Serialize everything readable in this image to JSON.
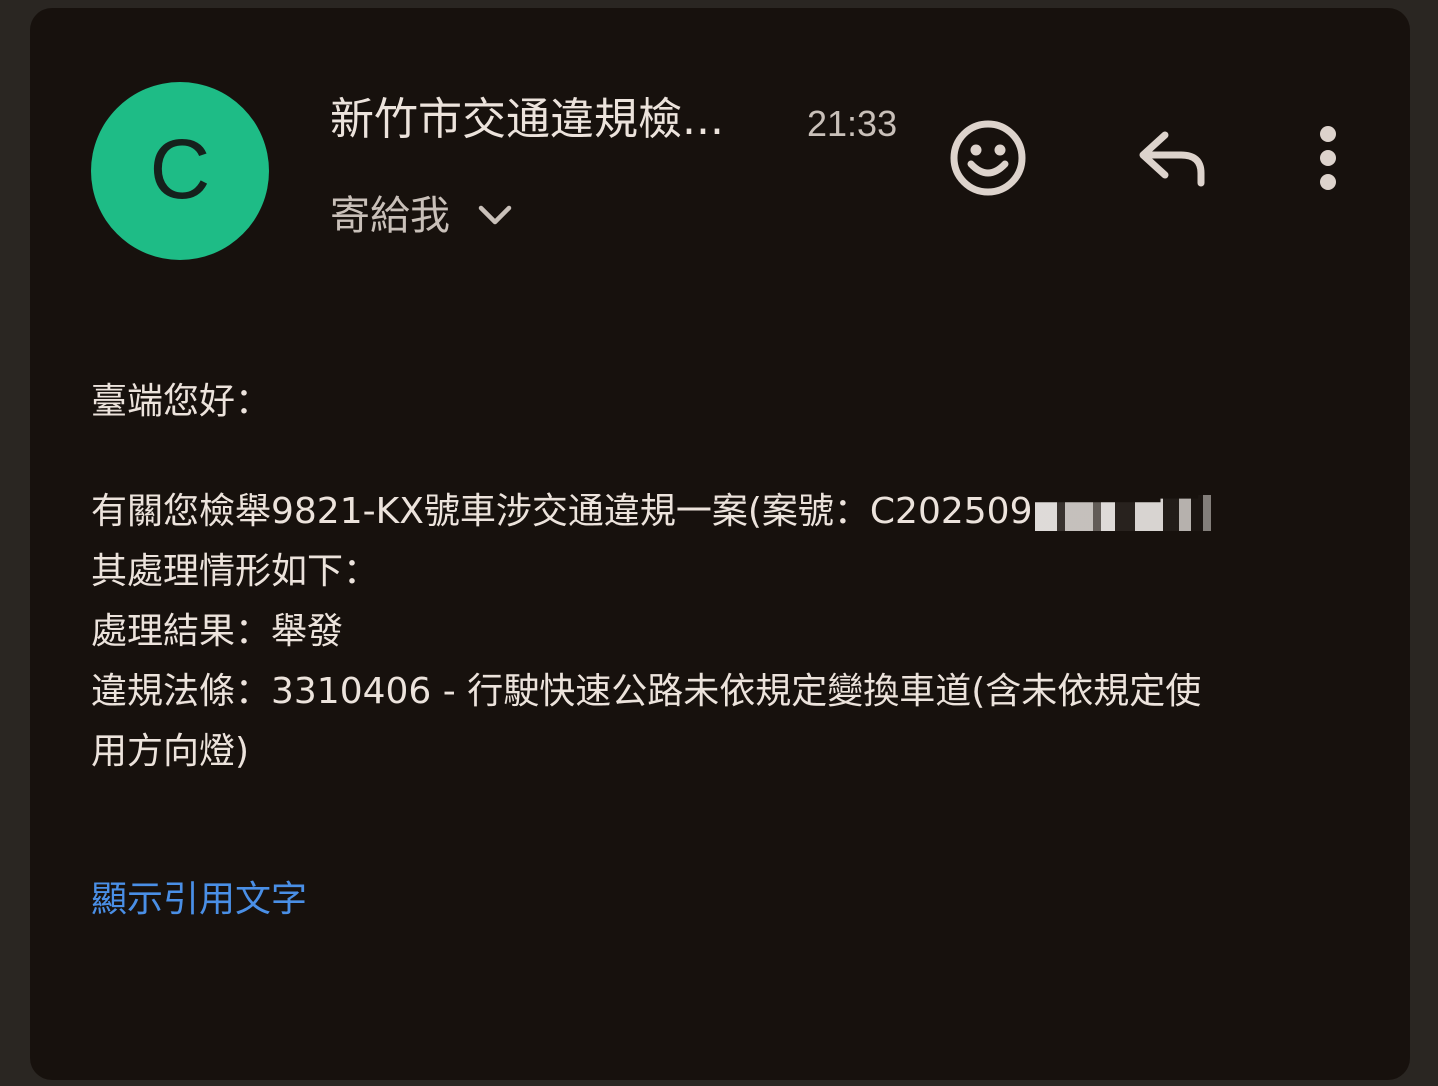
{
  "header": {
    "avatar_letter": "C",
    "sender": "新竹市交通違規檢...",
    "time": "21:33",
    "recipient_label": "寄給我"
  },
  "icons": {
    "emoji": "emoji-reaction-icon",
    "reply": "reply-icon",
    "more": "more-vertical-icon",
    "expand": "chevron-down-icon"
  },
  "colors": {
    "avatar": "#1ebc86",
    "link": "#4a8fe6",
    "background": "#17110d"
  },
  "body": {
    "greeting": "臺端您好：",
    "line1": "有關您檢舉9821-KX號車涉交通違規一案(案號：C202509",
    "line2": "其處理情形如下：",
    "line3": "處理結果：舉發",
    "line4": "違規法條：3310406 - 行駛快速公路未依規定變換車道(含未依規定使",
    "line5": "用方向燈)"
  },
  "show_quoted_label": "顯示引用文字"
}
